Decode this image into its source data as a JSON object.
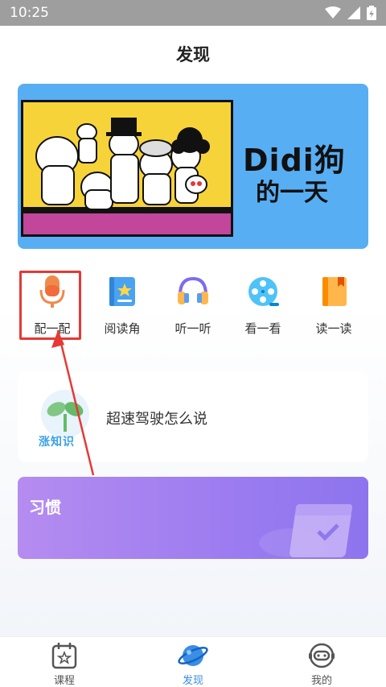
{
  "status_bar": {
    "time": "10:25"
  },
  "header": {
    "title": "发现"
  },
  "banner": {
    "title": "Didi狗",
    "subtitle": "的一天"
  },
  "features": [
    {
      "label": "配一配",
      "icon": "microphone-icon"
    },
    {
      "label": "阅读角",
      "icon": "book-icon"
    },
    {
      "label": "听一听",
      "icon": "headphones-icon"
    },
    {
      "label": "看一看",
      "icon": "film-reel-icon"
    },
    {
      "label": "读一读",
      "icon": "notebook-icon"
    }
  ],
  "knowledge_card": {
    "logo_text": "涨知识",
    "question": "超速驾驶怎么说"
  },
  "habit_card": {
    "title": "习惯"
  },
  "bottom_nav": {
    "items": [
      {
        "label": "课程",
        "icon": "calendar-star-icon"
      },
      {
        "label": "发现",
        "icon": "planet-icon",
        "active": true
      },
      {
        "label": "我的",
        "icon": "robot-face-icon"
      }
    ]
  },
  "colors": {
    "accent": "#3a8ee6",
    "highlight": "#e53935",
    "habit_gradient": "#9c7cf0",
    "banner_bg": "#58aef3"
  }
}
